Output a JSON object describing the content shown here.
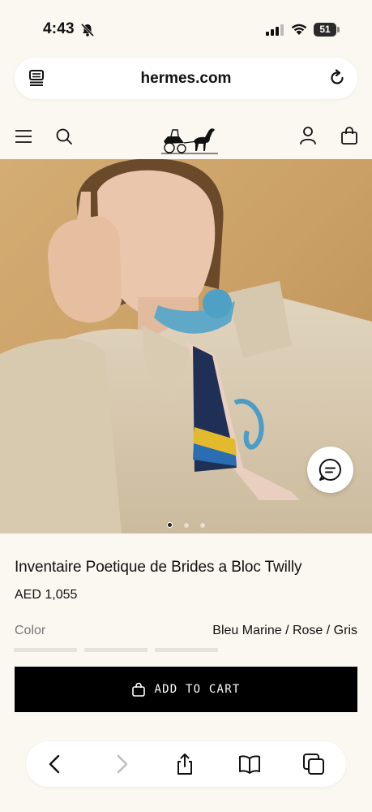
{
  "status": {
    "time": "4:43",
    "battery": "51"
  },
  "browser": {
    "url": "hermes.com"
  },
  "header": {
    "icons": [
      "menu-icon",
      "search-icon",
      "hermes-logo",
      "user-icon",
      "bag-icon"
    ]
  },
  "carousel": {
    "active_index": 0,
    "count": 3
  },
  "product": {
    "title": "Inventaire Poetique de Brides a Bloc Twilly",
    "price": "AED 1,055",
    "color_label": "Color",
    "color_value": "Bleu Marine / Rose / Gris",
    "swatch_count": 3
  },
  "cta": {
    "add_to_cart": "ADD TO CART"
  },
  "toolbar": {
    "icons": [
      "back-icon",
      "forward-icon",
      "share-icon",
      "bookmarks-icon",
      "tabs-icon"
    ]
  },
  "colors": {
    "accent": "#000000",
    "background": "#fbf8f2",
    "muted": "#777777"
  }
}
